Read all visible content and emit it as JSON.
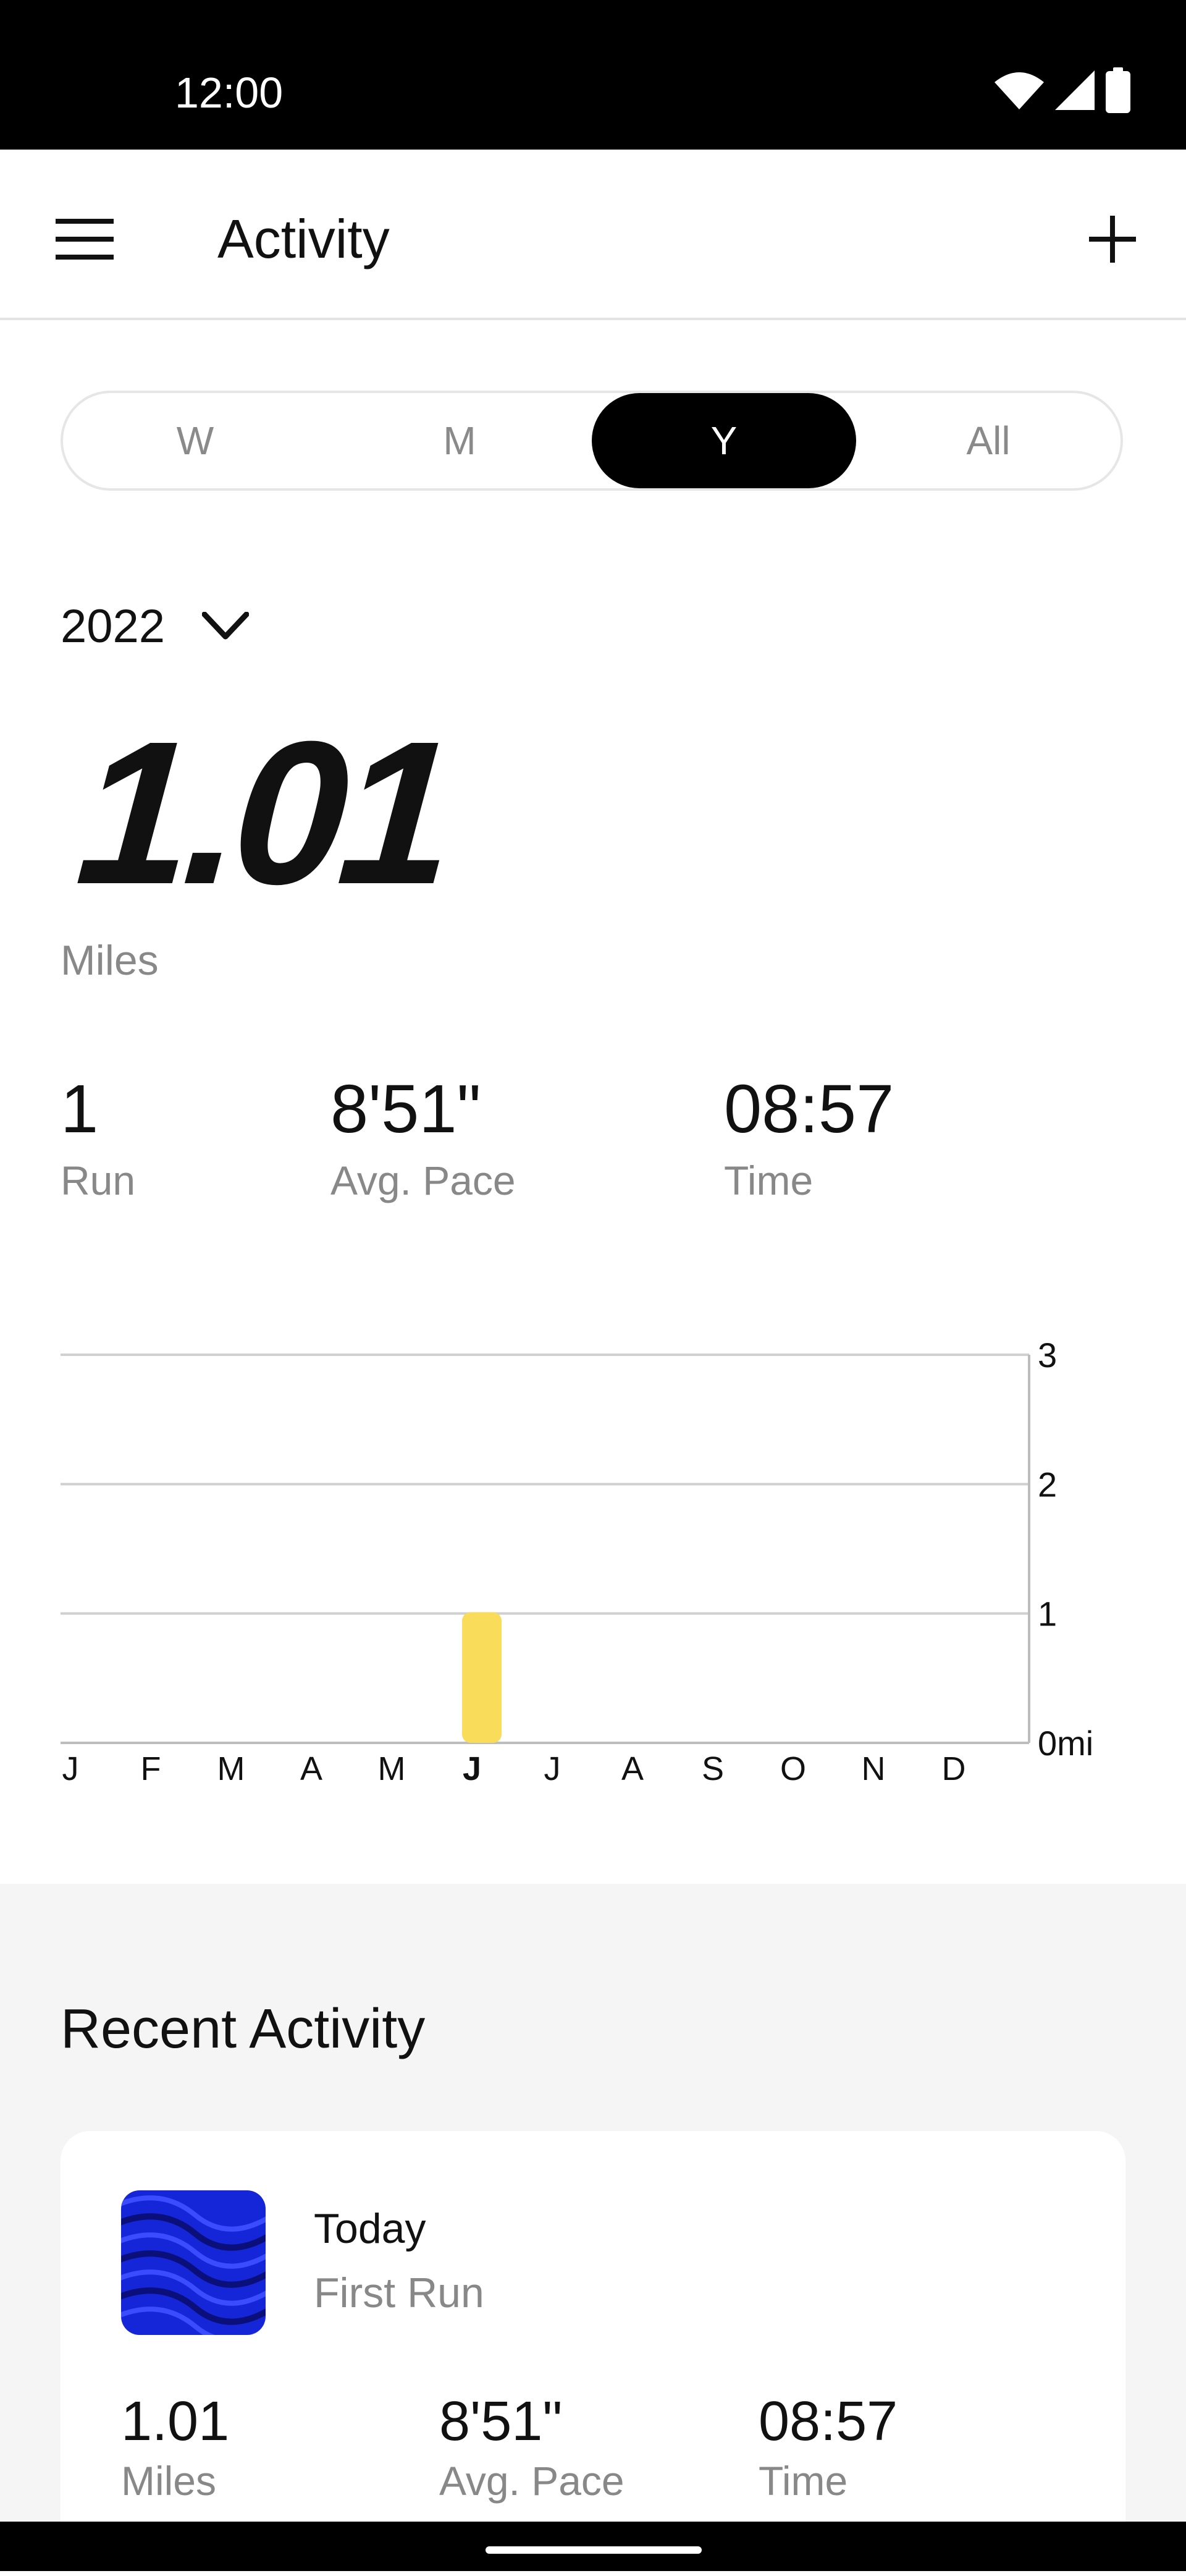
{
  "status_bar": {
    "time": "12:00"
  },
  "app_bar": {
    "title": "Activity"
  },
  "period_tabs": [
    {
      "label": "W",
      "active": false
    },
    {
      "label": "M",
      "active": false
    },
    {
      "label": "Y",
      "active": true
    },
    {
      "label": "All",
      "active": false
    }
  ],
  "year_selector": {
    "value": "2022"
  },
  "summary": {
    "distance_value": "1.01",
    "distance_unit": "Miles",
    "stats": [
      {
        "value": "1",
        "label": "Run"
      },
      {
        "value": "8'51\"",
        "label": "Avg. Pace"
      },
      {
        "value": "08:57",
        "label": "Time"
      }
    ]
  },
  "chart_data": {
    "type": "bar",
    "categories": [
      "J",
      "F",
      "M",
      "A",
      "M",
      "J",
      "J",
      "A",
      "S",
      "O",
      "N",
      "D"
    ],
    "values": [
      0,
      0,
      0,
      0,
      0,
      1.01,
      0,
      0,
      0,
      0,
      0,
      0
    ],
    "highlighted_index": 5,
    "y_ticks": [
      "0mi",
      "1",
      "2",
      "3"
    ],
    "ylim": [
      0,
      3
    ],
    "bar_color": "#f8dc5a",
    "grid": true,
    "y_axis_side": "right"
  },
  "recent_activity": {
    "title": "Recent Activity",
    "items": [
      {
        "date": "Today",
        "name": "First Run",
        "stats": [
          {
            "value": "1.01",
            "label": "Miles"
          },
          {
            "value": "8'51\"",
            "label": "Avg. Pace"
          },
          {
            "value": "08:57",
            "label": "Time"
          }
        ]
      }
    ]
  },
  "colors": {
    "accent": "#f8dc5a",
    "active_tab": "#000000",
    "muted_text": "#888888",
    "section_bg": "#f5f5f5",
    "thumbnail": "#1525d8"
  },
  "icons": {
    "menu": "menu-icon",
    "add": "plus-icon",
    "dropdown": "chevron-down-icon",
    "wifi": "wifi-icon",
    "signal": "signal-icon",
    "battery": "battery-icon"
  }
}
